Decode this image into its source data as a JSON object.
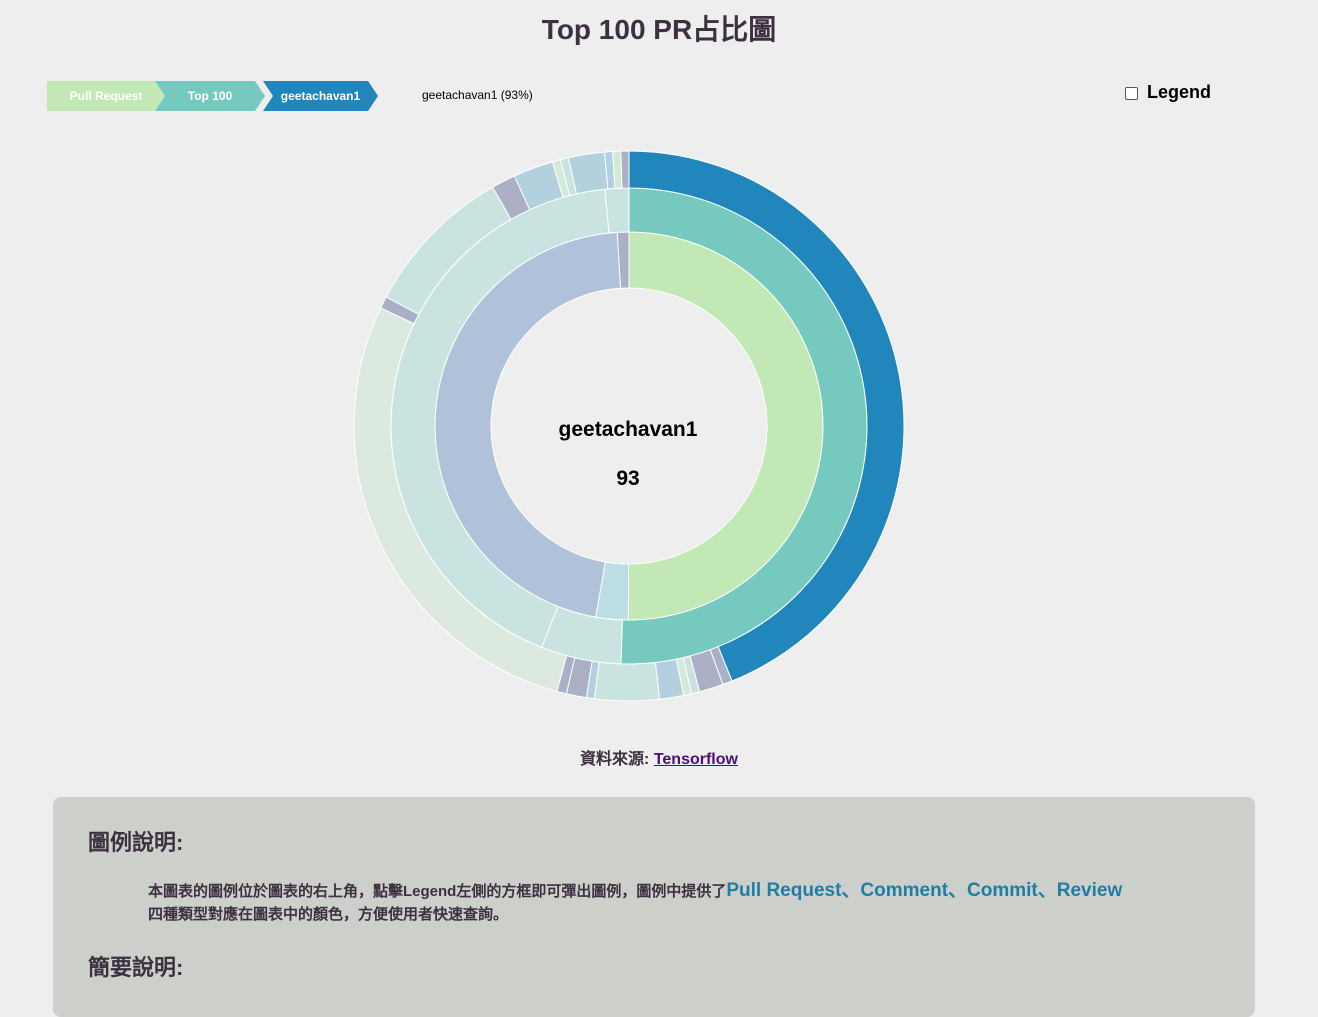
{
  "page": {
    "title": "Top 100 PR占比圖"
  },
  "breadcrumb": {
    "items": [
      {
        "label": "Pull Request",
        "color": "#c2e8b5"
      },
      {
        "label": "Top 100",
        "color": "#76c9bf"
      },
      {
        "label": "geetachavan1",
        "color": "#2186bc"
      }
    ],
    "percent_text": "geetachavan1 (93%)"
  },
  "legend": {
    "label": "Legend",
    "checked": false
  },
  "source": {
    "label": "資料來源:",
    "link_text": "Tensorflow"
  },
  "explanation": {
    "legend_heading": "圖例說明:",
    "text_before": "本圖表的圖例位於圖表的右上角，點擊Legend左側的方框即可彈出圖例，圖例中提供了",
    "highlight": "Pull Request、Comment、Commit、Review",
    "text_after": "四種類型對應在圖表中的顏色，方便使用者快速查詢。",
    "summary_heading": "簡要說明:"
  },
  "chart_data": {
    "type": "sunburst",
    "center_label": "geetachavan1",
    "center_value": "93",
    "rings": [
      {
        "name": "ring1",
        "segments": [
          {
            "value": 93.0,
            "color": "#c2e8b5"
          },
          {
            "value": 5.0,
            "color": "#bcdde3"
          },
          {
            "value": 86.0,
            "color": "#b0c2da"
          },
          {
            "value": 1.8,
            "color": "#abb0c6"
          }
        ]
      },
      {
        "name": "ring2",
        "segments": [
          {
            "value": 93.0,
            "color": "#76c9bf"
          },
          {
            "value": 10.0,
            "color": "#c9e4e0"
          },
          {
            "value": 78.0,
            "color": "#c9e4e0"
          },
          {
            "value": 3.0,
            "color": "#c9e4e0"
          }
        ]
      },
      {
        "name": "ring3",
        "segments": [
          {
            "value": 93.0,
            "color": "#2186bc"
          },
          {
            "value": 1.2,
            "color": "#abb0c6"
          },
          {
            "value": 3.0,
            "color": "#abb0c6"
          },
          {
            "value": 1.0,
            "color": "#c9e4e0"
          },
          {
            "value": 1.0,
            "color": "#d3ead8"
          },
          {
            "value": 3.0,
            "color": "#b2d0de"
          },
          {
            "value": 8.0,
            "color": "#c9e4e0"
          },
          {
            "value": 1.0,
            "color": "#b2d0de"
          },
          {
            "value": 2.5,
            "color": "#abb0c6"
          },
          {
            "value": 1.2,
            "color": "#abb0c6"
          },
          {
            "value": 59.0,
            "color": "#dbe9df"
          },
          {
            "value": 1.5,
            "color": "#abb0c6"
          },
          {
            "value": 19.0,
            "color": "#c9e4e0"
          },
          {
            "value": 3.0,
            "color": "#abb0c6"
          },
          {
            "value": 5.0,
            "color": "#b2d0de"
          },
          {
            "value": 1.0,
            "color": "#d3ead8"
          },
          {
            "value": 1.0,
            "color": "#c9e4e0"
          },
          {
            "value": 4.5,
            "color": "#b2d0de"
          },
          {
            "value": 1.0,
            "color": "#b2d0de"
          },
          {
            "value": 1.0,
            "color": "#d3ead8"
          },
          {
            "value": 1.0,
            "color": "#abb0c6"
          }
        ]
      }
    ]
  }
}
